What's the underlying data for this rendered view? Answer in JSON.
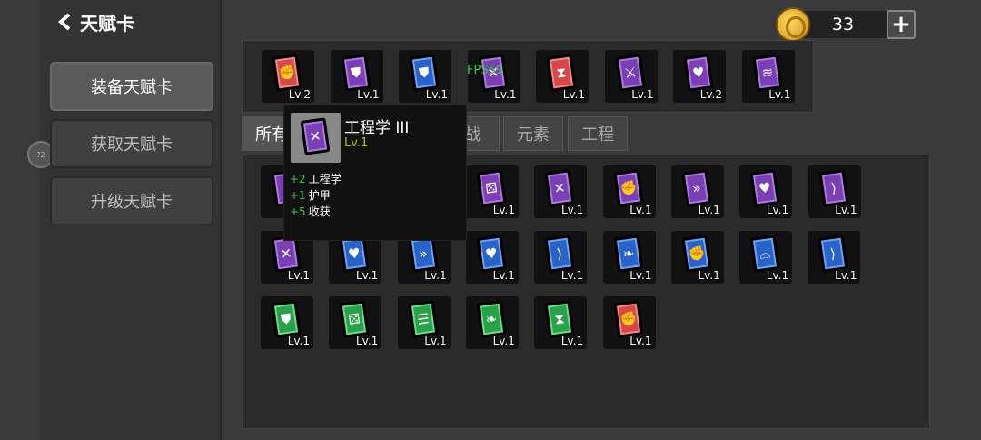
{
  "header": {
    "title": "天赋卡"
  },
  "sidebar": {
    "items": [
      {
        "label": "装备天赋卡",
        "active": true
      },
      {
        "label": "获取天赋卡",
        "active": false
      },
      {
        "label": "升级天赋卡",
        "active": false
      }
    ]
  },
  "edge_badge": "?2",
  "currency": {
    "amount": "33",
    "add_label": "+"
  },
  "fps_label": "FPS59",
  "equipped": [
    {
      "color": "red",
      "icon": "fist-icon",
      "glyph": "✊",
      "level": "Lv.2"
    },
    {
      "color": "purple",
      "icon": "shield-icon",
      "glyph": "⛊",
      "level": "Lv.1"
    },
    {
      "color": "blue",
      "icon": "shield-icon",
      "glyph": "⛊",
      "level": "Lv.1"
    },
    {
      "color": "purple",
      "icon": "wrench-icon",
      "glyph": "✕",
      "level": "Lv.1"
    },
    {
      "color": "red",
      "icon": "hourglass-icon",
      "glyph": "⧗",
      "level": "Lv.1"
    },
    {
      "color": "purple",
      "icon": "sword-icon",
      "glyph": "⚔",
      "level": "Lv.1"
    },
    {
      "color": "purple",
      "icon": "heart-plus-icon",
      "glyph": "♥",
      "level": "Lv.2"
    },
    {
      "color": "purple",
      "icon": "wifi-icon",
      "glyph": "≋",
      "level": "Lv.1"
    }
  ],
  "tabs": [
    {
      "label": "所有",
      "active": true
    },
    {
      "label": "战",
      "active": false
    },
    {
      "label": "元素",
      "active": false
    },
    {
      "label": "工程",
      "active": false
    }
  ],
  "cards_row1": [
    {
      "color": "purple",
      "icon": "dice-icon",
      "glyph": "⚄",
      "level": "Lv.1"
    },
    {
      "color": "purple",
      "icon": "wrench-icon",
      "glyph": "✕",
      "level": "Lv.1"
    },
    {
      "color": "purple",
      "icon": "fist-icon",
      "glyph": "✊",
      "level": "Lv.1"
    },
    {
      "color": "purple",
      "icon": "speed-icon",
      "glyph": "»",
      "level": "Lv.1"
    },
    {
      "color": "purple",
      "icon": "heart-icon",
      "glyph": "♥",
      "level": "Lv.1"
    },
    {
      "color": "purple",
      "icon": "bow-icon",
      "glyph": "⟩",
      "level": "Lv.1"
    }
  ],
  "cards_row2": [
    {
      "color": "purple",
      "icon": "wrench-icon",
      "glyph": "✕",
      "level": "Lv.1"
    },
    {
      "color": "blue",
      "icon": "heart-plus-icon",
      "glyph": "♥",
      "level": "Lv.1"
    },
    {
      "color": "blue",
      "icon": "speed-icon",
      "glyph": "»",
      "level": "Lv.1"
    },
    {
      "color": "blue",
      "icon": "heart-icon",
      "glyph": "♥",
      "level": "Lv.1"
    },
    {
      "color": "blue",
      "icon": "bow-icon",
      "glyph": "⟩",
      "level": "Lv.1"
    },
    {
      "color": "blue",
      "icon": "feather-icon",
      "glyph": "❧",
      "level": "Lv.1"
    },
    {
      "color": "blue",
      "icon": "fist-icon",
      "glyph": "✊",
      "level": "Lv.1"
    },
    {
      "color": "blue",
      "icon": "helmet-icon",
      "glyph": "⌓",
      "level": "Lv.1"
    },
    {
      "color": "blue",
      "icon": "bow-icon",
      "glyph": "⟩",
      "level": "Lv.1"
    }
  ],
  "cards_row3": [
    {
      "color": "green",
      "icon": "shield-icon",
      "glyph": "⛊",
      "level": "Lv.1"
    },
    {
      "color": "green",
      "icon": "dice-icon",
      "glyph": "⚄",
      "level": "Lv.1"
    },
    {
      "color": "green",
      "icon": "book-icon",
      "glyph": "☰",
      "level": "Lv.1"
    },
    {
      "color": "green",
      "icon": "feather-icon",
      "glyph": "❧",
      "level": "Lv.1"
    },
    {
      "color": "green",
      "icon": "hourglass-icon",
      "glyph": "⧗",
      "level": "Lv.1"
    },
    {
      "color": "red",
      "icon": "fist-icon",
      "glyph": "✊",
      "level": "Lv.1"
    }
  ],
  "tooltip": {
    "title": "工程学 III",
    "level": "Lv.1",
    "icon": "wrench-icon",
    "glyph": "✕",
    "stats": [
      {
        "value": "+2",
        "label": "工程学"
      },
      {
        "value": "+1",
        "label": "护甲"
      },
      {
        "value": "+5",
        "label": "收获"
      }
    ]
  },
  "colors": {
    "purple": "#7b3fb5",
    "blue": "#2a63c8",
    "red": "#d64848",
    "green": "#2aa04a",
    "stat_value": "#3ec84a",
    "level_text": "#a8c820"
  }
}
